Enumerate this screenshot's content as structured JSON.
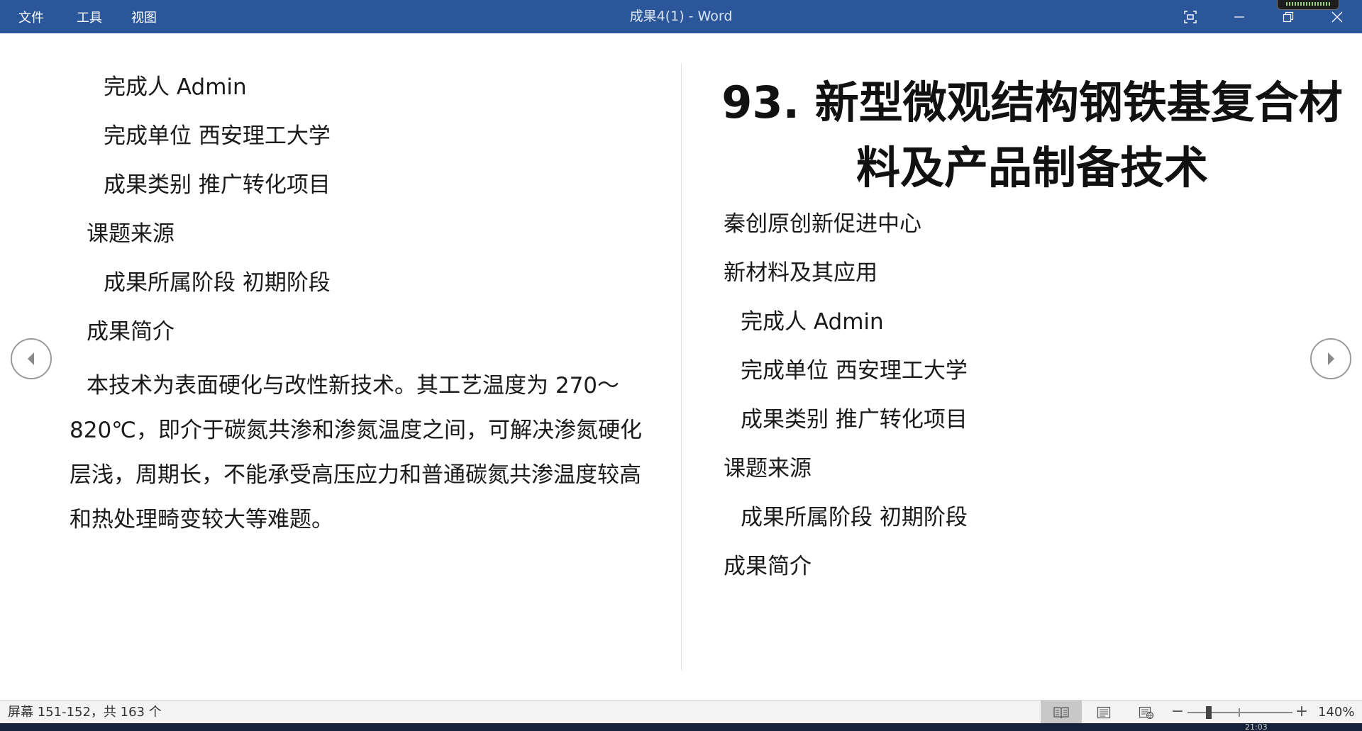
{
  "window": {
    "menu": [
      "文件",
      "工具",
      "视图"
    ],
    "title": "成果4(1)  -  Word"
  },
  "left_page": {
    "lines": [
      "完成人  Admin",
      "完成单位  西安理工大学",
      "成果类别  推广转化项目",
      "课题来源",
      "成果所属阶段  初期阶段",
      "成果简介"
    ],
    "body": "本技术为表面硬化与改性新技术。其工艺温度为 270～820℃，即介于碳氮共渗和渗氮温度之间，可解决渗氮硬化层浅，周期长，不能承受高压应力和普通碳氮共渗温度较高和热处理畸变较大等难题。"
  },
  "right_page": {
    "heading": "93.  新型微观结构钢铁基复合材料及产品制备技术",
    "lines": [
      "秦创原创新促进中心",
      "新材料及其应用",
      "完成人  Admin",
      "完成单位  西安理工大学",
      "成果类别  推广转化项目",
      "课题来源",
      "成果所属阶段  初期阶段",
      "成果简介"
    ]
  },
  "status": {
    "screen_info": "屏幕 151-152，共 163 个",
    "zoom_minus": "−",
    "zoom_plus": "+",
    "zoom": "140%",
    "clock_fragment": "21:03"
  },
  "colors": {
    "titlebar": "#2b579a",
    "statusbar": "#f3f3f3",
    "text": "#1a1a1a"
  },
  "icons": {
    "focus": "focus-mode-icon",
    "minimize": "minimize-icon",
    "restore": "restore-icon",
    "close": "close-icon",
    "prev": "chevron-left-icon",
    "next": "chevron-right-icon",
    "read_mode": "read-mode-icon",
    "print_layout": "print-layout-icon",
    "web_layout": "web-layout-icon"
  }
}
